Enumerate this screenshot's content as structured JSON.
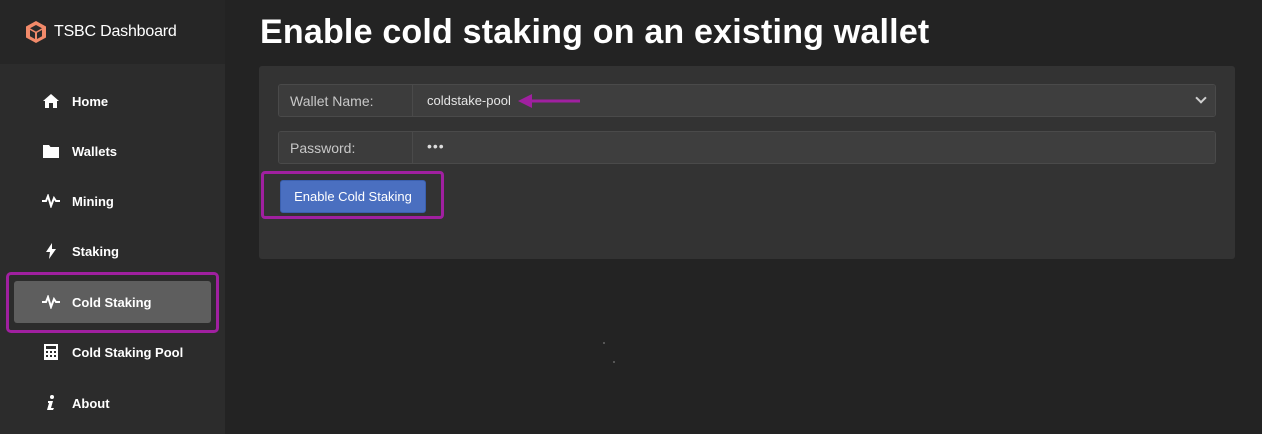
{
  "brand": {
    "title": "TSBC Dashboard",
    "logo_icon": "hexagon-box-icon",
    "logo_color": "#f28a6a"
  },
  "sidebar": {
    "items": [
      {
        "label": "Home",
        "icon": "home-icon",
        "active": false
      },
      {
        "label": "Wallets",
        "icon": "folder-icon",
        "active": false
      },
      {
        "label": "Mining",
        "icon": "pulse-icon",
        "active": false
      },
      {
        "label": "Staking",
        "icon": "bolt-icon",
        "active": false
      },
      {
        "label": "Cold Staking",
        "icon": "pulse-icon",
        "active": true
      },
      {
        "label": "Cold Staking Pool",
        "icon": "calculator-icon",
        "active": false
      },
      {
        "label": "About",
        "icon": "info-icon",
        "active": false
      }
    ]
  },
  "main": {
    "title": "Enable cold staking on an existing wallet",
    "form": {
      "wallet_label": "Wallet Name:",
      "wallet_value": "coldstake-pool",
      "password_label": "Password:",
      "password_value": "•••",
      "submit_label": "Enable Cold Staking"
    }
  },
  "colors": {
    "accent": "#4a6fc0",
    "annotation": "#a020a0",
    "active_nav": "#5e5e5e"
  }
}
